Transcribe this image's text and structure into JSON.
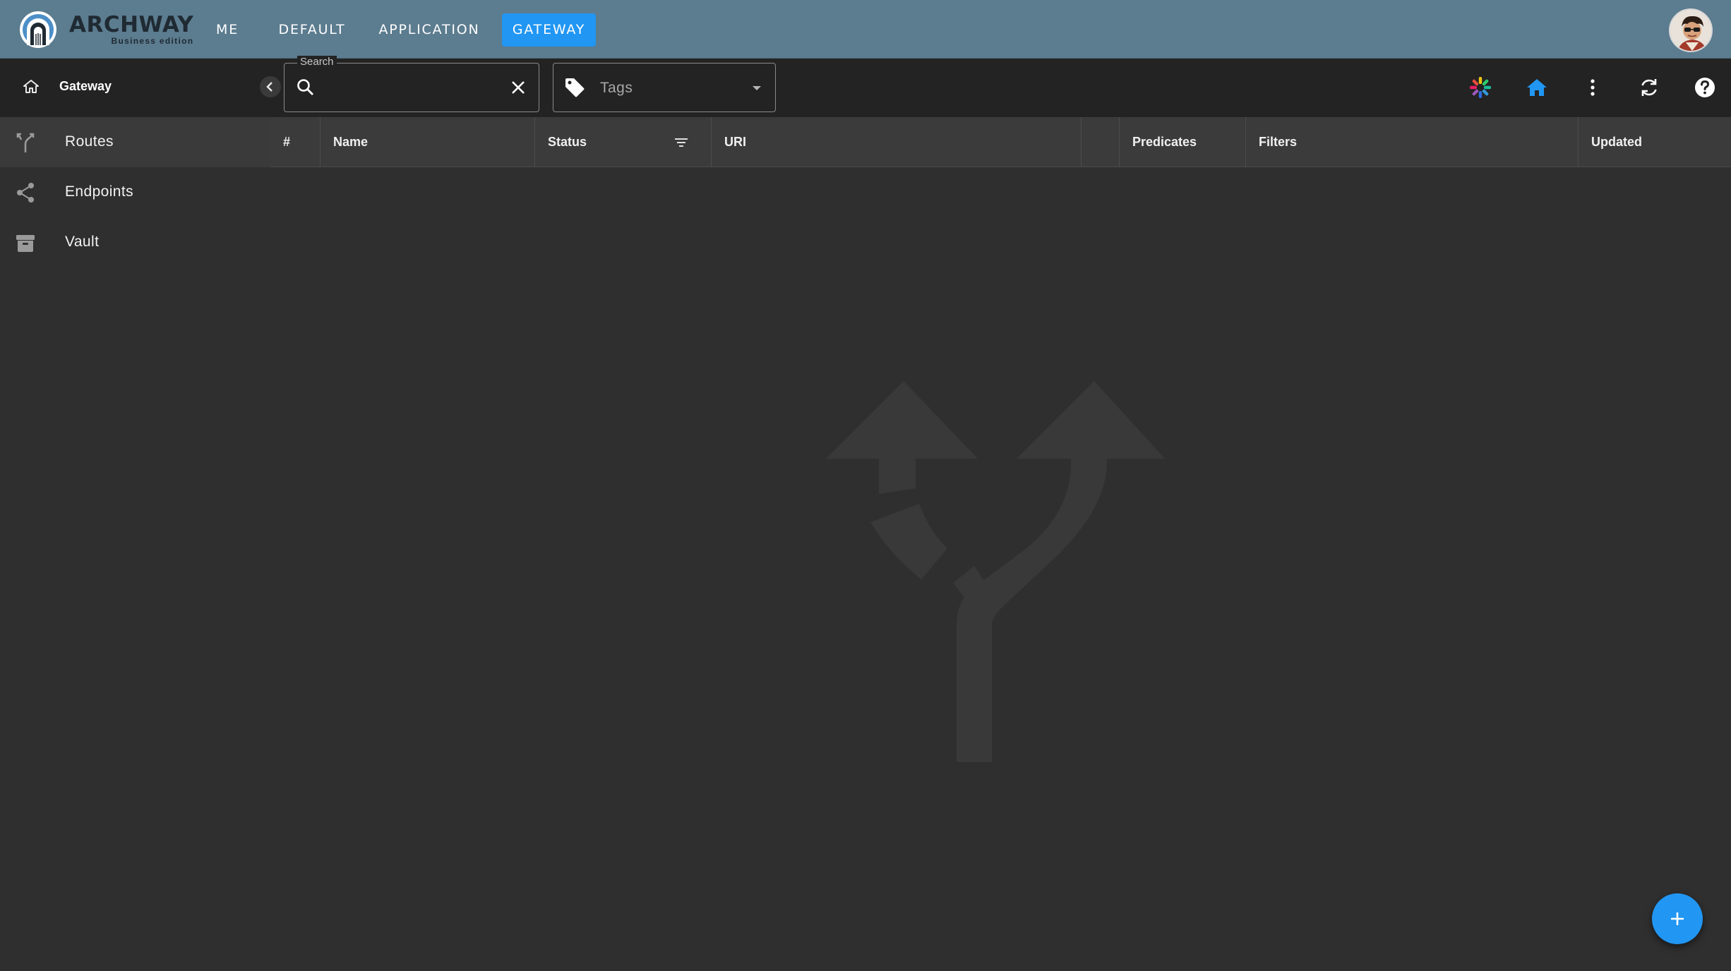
{
  "brand": {
    "name": "ARCHWAY",
    "edition": "Business edition"
  },
  "nav": {
    "tabs": [
      {
        "label": "ME"
      },
      {
        "label": "DEFAULT"
      },
      {
        "label": "APPLICATION"
      },
      {
        "label": "GATEWAY",
        "active": true
      }
    ]
  },
  "sidebar": {
    "title": "Gateway",
    "items": [
      {
        "label": "Routes",
        "icon": "fork-icon",
        "active": true
      },
      {
        "label": "Endpoints",
        "icon": "share-icon"
      },
      {
        "label": "Vault",
        "icon": "archive-icon"
      }
    ]
  },
  "toolbar": {
    "search_legend": "Search",
    "search_value": "",
    "tags_placeholder": "Tags",
    "icons": [
      "spinner-logo-icon",
      "home-icon",
      "more-vert-icon",
      "refresh-icon",
      "help-icon"
    ]
  },
  "table": {
    "columns": [
      "#",
      "Name",
      "Status",
      "URI",
      "",
      "Predicates",
      "Filters",
      "Updated"
    ],
    "rows": []
  },
  "colors": {
    "appbar": "#5c7c8f",
    "accent": "#2196f3",
    "background": "#2f2f2f",
    "toolbar": "#232323",
    "header": "#3b3b3b"
  }
}
